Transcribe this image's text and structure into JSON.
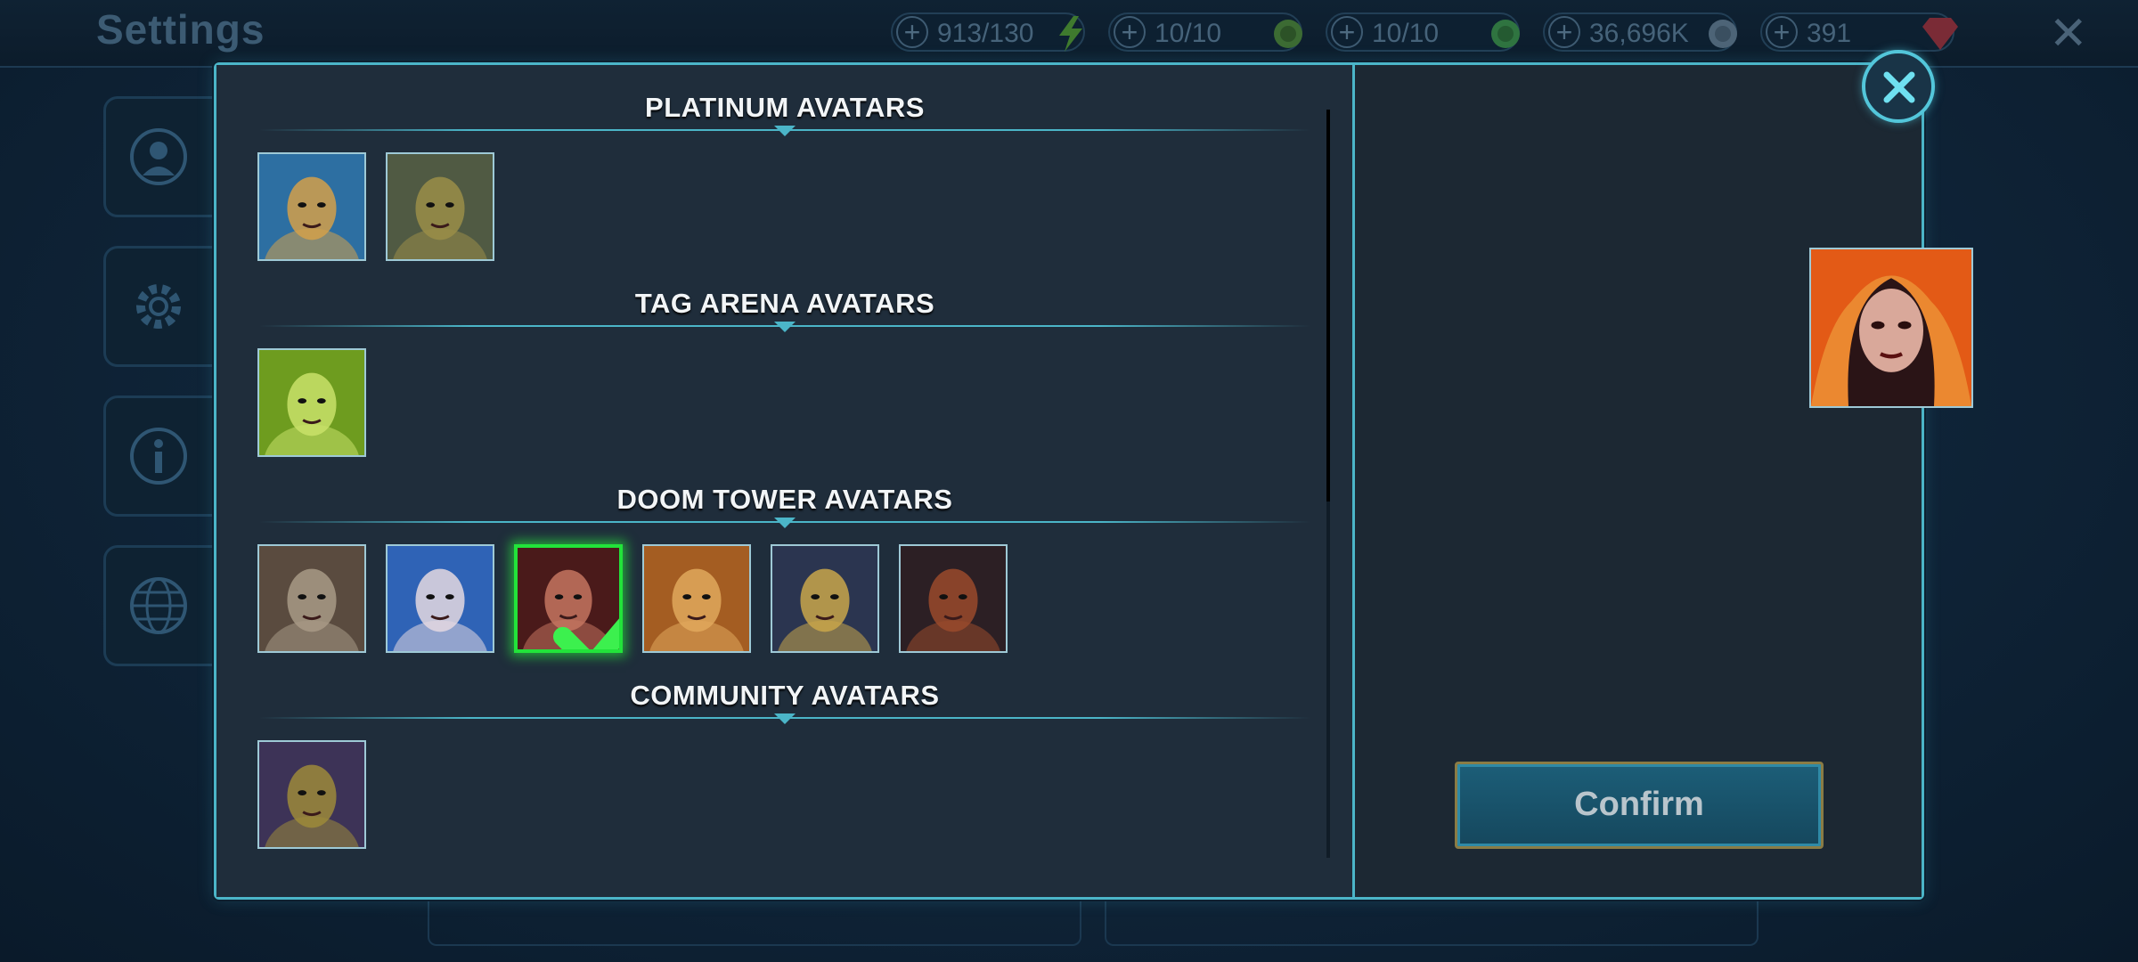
{
  "background": {
    "title": "Settings",
    "resources": [
      {
        "value": "913/130",
        "icon": "energy-icon"
      },
      {
        "value": "10/10",
        "icon": "arena-token-icon"
      },
      {
        "value": "10/10",
        "icon": "tag-arena-token-icon"
      },
      {
        "value": "36,696K",
        "icon": "silver-icon"
      },
      {
        "value": "391",
        "icon": "gem-icon"
      }
    ],
    "side_tabs": [
      "profile-icon",
      "gear-icon",
      "info-icon",
      "globe-icon"
    ]
  },
  "modal": {
    "sections": [
      {
        "title": "PLATINUM AVATARS",
        "avatars": [
          {
            "name": "avatar-platinum-1",
            "colors": [
              "#2d6fa2",
              "#d3a04a"
            ]
          },
          {
            "name": "avatar-platinum-2",
            "colors": [
              "#505a43",
              "#9a8e48"
            ]
          }
        ]
      },
      {
        "title": "TAG ARENA AVATARS",
        "avatars": [
          {
            "name": "avatar-tag-arena-1",
            "colors": [
              "#6e9c1f",
              "#c9e26a"
            ]
          }
        ]
      },
      {
        "title": "DOOM TOWER AVATARS",
        "avatars": [
          {
            "name": "avatar-doom-tower-1",
            "colors": [
              "#5a4b3f",
              "#a89a86"
            ]
          },
          {
            "name": "avatar-doom-tower-2",
            "colors": [
              "#2f63b6",
              "#e4d8e0"
            ]
          },
          {
            "name": "avatar-doom-tower-3",
            "colors": [
              "#4a1a1a",
              "#c47560"
            ],
            "selected": true
          },
          {
            "name": "avatar-doom-tower-4",
            "colors": [
              "#a45d22",
              "#e0a85c"
            ]
          },
          {
            "name": "avatar-doom-tower-5",
            "colors": [
              "#2b3550",
              "#c9a64a"
            ]
          },
          {
            "name": "avatar-doom-tower-6",
            "colors": [
              "#2c1f24",
              "#9a4a2c"
            ]
          }
        ]
      },
      {
        "title": "COMMUNITY AVATARS",
        "avatars": [
          {
            "name": "avatar-community-1",
            "colors": [
              "#3d3357",
              "#9c8a3a"
            ]
          }
        ]
      }
    ],
    "preview": {
      "colors": [
        "#e35a16",
        "#f3b64a"
      ]
    },
    "confirm_label": "Confirm",
    "close_icon": "close-icon",
    "selected_check_icon": "checkmark-icon",
    "accent_color": "#4bb5c8",
    "selected_color": "#22e33a"
  }
}
